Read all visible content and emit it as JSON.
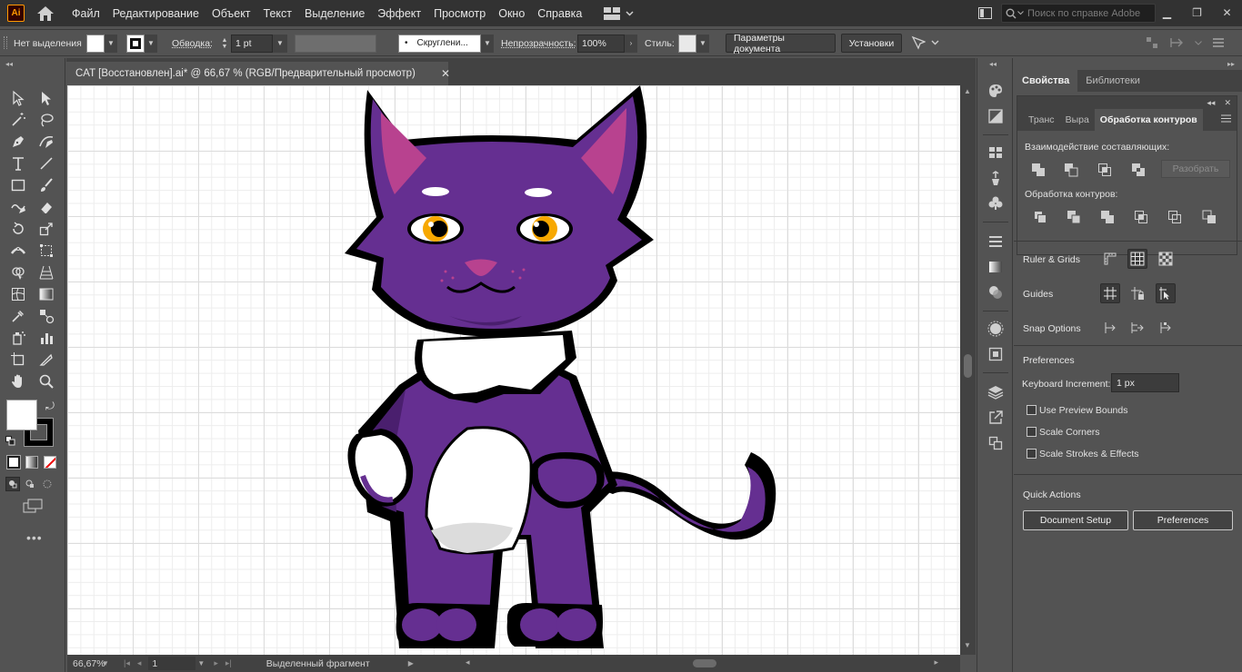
{
  "menubar": {
    "app_logo": "Ai",
    "menus": [
      "Файл",
      "Редактирование",
      "Объект",
      "Текст",
      "Выделение",
      "Эффект",
      "Просмотр",
      "Окно",
      "Справка"
    ],
    "help_placeholder": "Поиск по справке Adobe"
  },
  "controlbar": {
    "selection_label": "Нет выделения",
    "stroke_label": "Обводка:",
    "stroke_weight": "1 pt",
    "brush_label": "Скруглени...",
    "opacity_label": "Непрозрачность:",
    "opacity_value": "100%",
    "style_label": "Стиль:",
    "doc_setup_button": "Параметры документа",
    "preferences_button": "Установки"
  },
  "document": {
    "tab_title": "CAT [Восстановлен].ai* @ 66,67 % (RGB/Предварительный просмотр)"
  },
  "statusbar": {
    "zoom": "66,67%",
    "artboard": "1",
    "status_text": "Выделенный фрагмент"
  },
  "panel": {
    "tabs": [
      "Свойства",
      "Библиотеки"
    ],
    "pathfinder": {
      "tabs": [
        "Транс",
        "Выра",
        "Обработка контуров"
      ],
      "shape_modes_label": "Взаимодействие составляющих:",
      "expand_button": "Разобрать",
      "pathfinders_label": "Обработка контуров:"
    },
    "ruler_grids_label": "Ruler & Grids",
    "guides_label": "Guides",
    "snap_options_label": "Snap Options",
    "preferences_label": "Preferences",
    "keyboard_increment_label": "Keyboard Increment:",
    "keyboard_increment_value": "1 px",
    "checkboxes": [
      "Use Preview Bounds",
      "Scale Corners",
      "Scale Strokes & Effects"
    ],
    "quick_actions_label": "Quick Actions",
    "document_setup_button": "Document Setup",
    "preferences_button": "Preferences"
  },
  "colors": {
    "cat_purple": "#652f91",
    "cat_dark_purple": "#4a1f6e",
    "ear_pink": "#b8428f",
    "eye_yellow": "#f7a800",
    "belly_white": "#ffffff"
  }
}
